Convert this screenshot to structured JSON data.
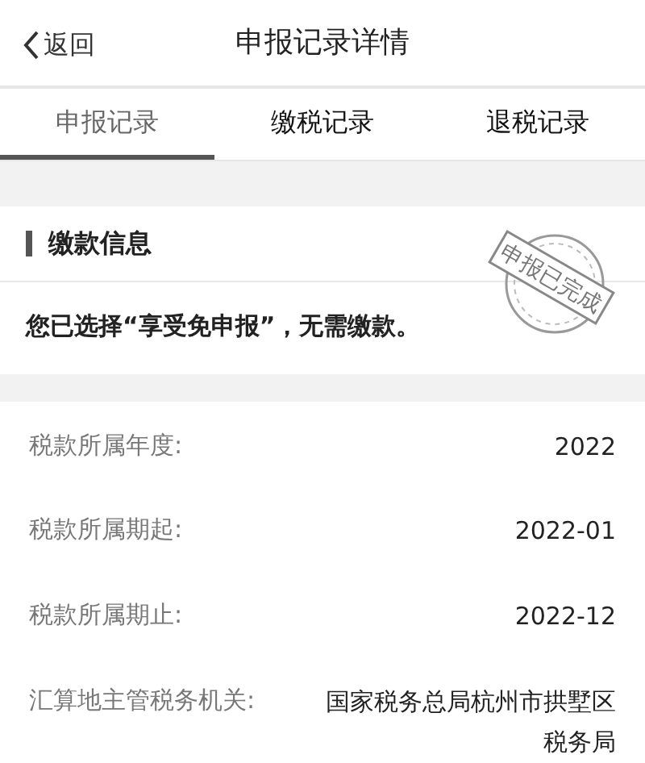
{
  "nav": {
    "back": "返回",
    "title": "申报记录详情"
  },
  "tabs": [
    {
      "label": "申报记录",
      "selected": true
    },
    {
      "label": "缴税记录",
      "selected": false
    },
    {
      "label": "退税记录",
      "selected": false
    }
  ],
  "payment": {
    "heading": "缴款信息",
    "stamp": "申报已完成",
    "message": "您已选择“享受免申报”，无需缴款。"
  },
  "details": [
    {
      "label": "税款所属年度:",
      "value": "2022"
    },
    {
      "label": "税款所属期起:",
      "value": "2022-01"
    },
    {
      "label": "税款所属期止:",
      "value": "2022-12"
    },
    {
      "label": "汇算地主管税务机关:",
      "value": "国家税务总局杭州市拱墅区税务局"
    }
  ]
}
